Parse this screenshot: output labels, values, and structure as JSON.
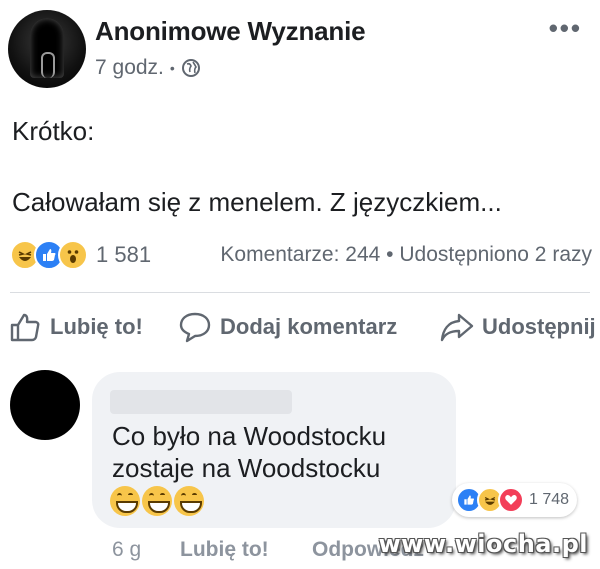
{
  "post": {
    "author": "Anonimowe Wyznanie",
    "time": "7 godz.",
    "separator": "•",
    "audience_icon": "globe-icon",
    "more_label": "•••",
    "text_line1": "Krótko:",
    "text_line2": "Całowałam się z menelem. Z języczkiem..."
  },
  "reactions": {
    "icons": [
      "haha-icon",
      "like-icon",
      "wow-icon"
    ],
    "count": "1 581",
    "comments": "Komentarze: 244",
    "sep": "•",
    "shares": "Udostępniono 2 razy"
  },
  "actions": {
    "like": "Lubię to!",
    "comment": "Dodaj komentarz",
    "share": "Udostępnij"
  },
  "comment": {
    "text": "Co było na Woodstocku\nzostaje na Woodstocku",
    "emojis": [
      "grin-icon",
      "grin-icon",
      "grin-icon"
    ],
    "reaction_icons": [
      "like-icon",
      "haha-icon",
      "love-icon"
    ],
    "reaction_count": "1 748",
    "time": "6 g",
    "like": "Lubię to!",
    "reply": "Odpowiedz"
  },
  "watermark": "www.wiocha.pl",
  "colors": {
    "like_blue": "#2c80f5",
    "love_red": "#f33e58",
    "emoji_yellow": "#f7c54a",
    "secondary_text": "#606770"
  }
}
